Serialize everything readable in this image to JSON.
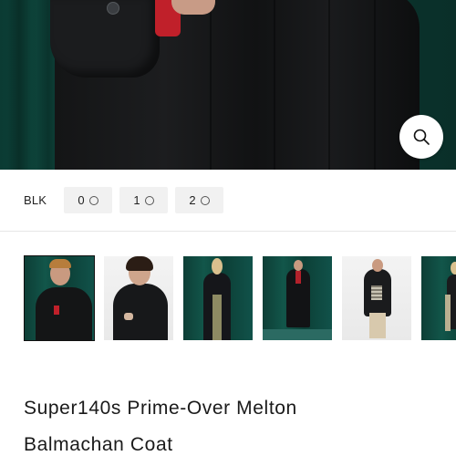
{
  "product": {
    "color": "BLK",
    "sizes": [
      {
        "label": "0",
        "stock_icon": "circle-available-icon"
      },
      {
        "label": "1",
        "stock_icon": "circle-available-icon"
      },
      {
        "label": "2",
        "stock_icon": "circle-available-icon"
      }
    ],
    "title_line1": "Super140s Prime-Over Melton",
    "title_line2": "Balmachan Coat"
  },
  "hero": {
    "zoom_icon": "search-icon"
  },
  "thumbnails": [
    {
      "name": "thumbnail-1",
      "background": "green",
      "selected": true
    },
    {
      "name": "thumbnail-2",
      "background": "grey",
      "selected": false
    },
    {
      "name": "thumbnail-3",
      "background": "green",
      "selected": false
    },
    {
      "name": "thumbnail-4",
      "background": "green",
      "selected": false
    },
    {
      "name": "thumbnail-5",
      "background": "grey",
      "selected": false
    },
    {
      "name": "thumbnail-6",
      "background": "green",
      "selected": false
    }
  ],
  "colors": {
    "accent": "#111111",
    "chip_bg": "#f1f1f1",
    "curtain_green": "#0f4a40",
    "coat_black": "#151617"
  }
}
